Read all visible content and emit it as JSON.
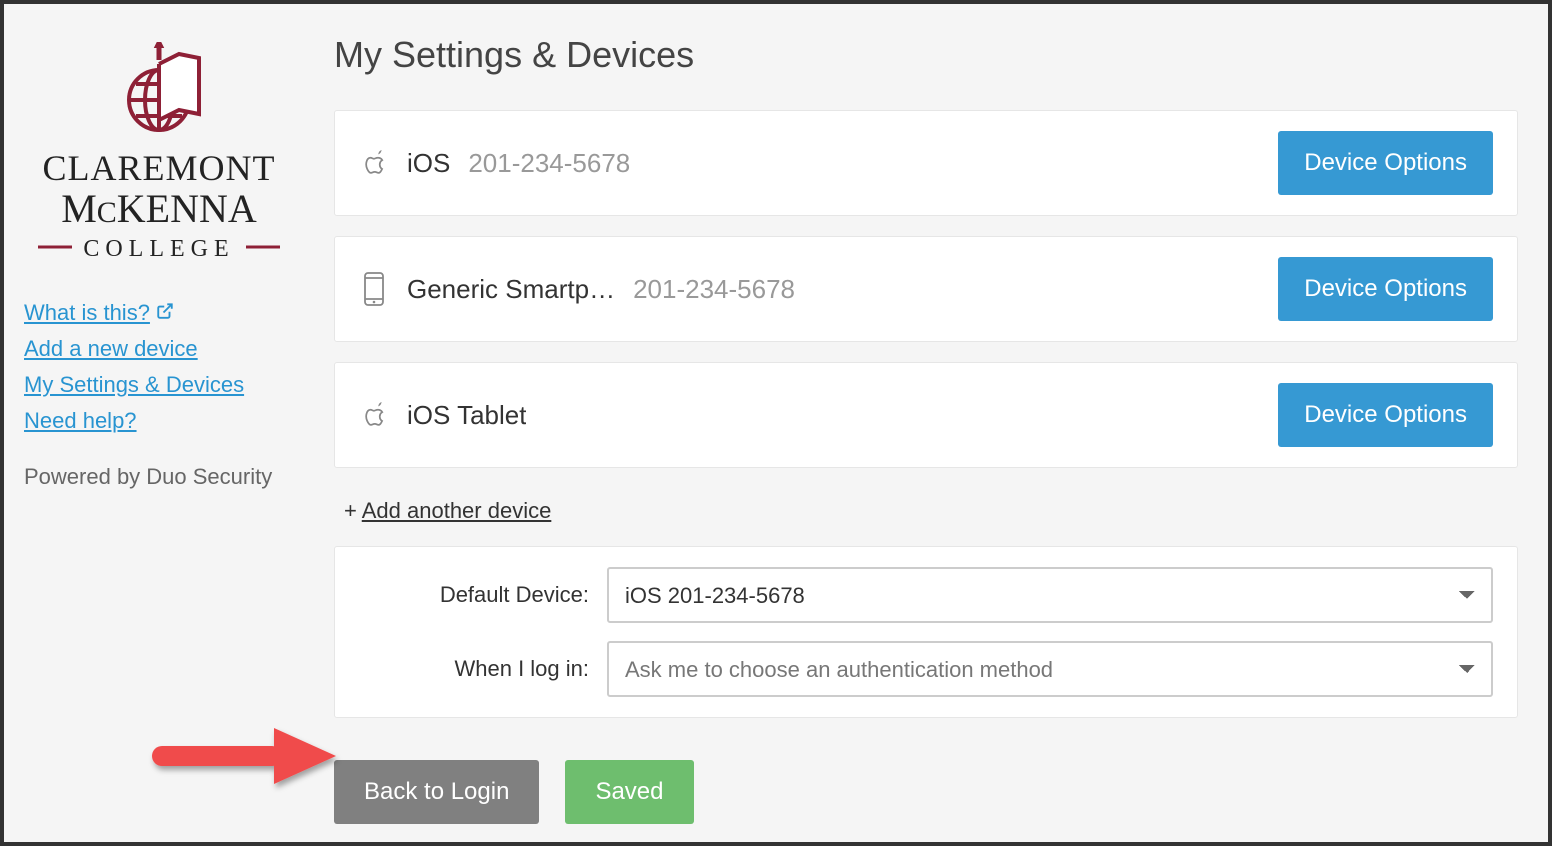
{
  "brand": {
    "line1": "CLAREMONT",
    "line2": "MCKENNA",
    "line3": "COLLEGE"
  },
  "sidebar": {
    "links": {
      "what": "What is this?",
      "add": "Add a new device",
      "settings": "My Settings & Devices",
      "help": "Need help?"
    },
    "powered": "Powered by Duo Security"
  },
  "page": {
    "title": "My Settings & Devices"
  },
  "devices": [
    {
      "name": "iOS",
      "phone": "201-234-5678",
      "btn": "Device Options",
      "icon": "apple"
    },
    {
      "name": "Generic Smartp…",
      "phone": "201-234-5678",
      "btn": "Device Options",
      "icon": "phone"
    },
    {
      "name": "iOS Tablet",
      "phone": "",
      "btn": "Device Options",
      "icon": "apple"
    }
  ],
  "addAnother": {
    "plus": "+ ",
    "label": "Add another device"
  },
  "settings": {
    "defaultLabel": "Default Device:",
    "defaultValue": "iOS 201-234-5678",
    "loginLabel": "When I log in:",
    "loginValue": "Ask me to choose an authentication method"
  },
  "actions": {
    "back": "Back to Login",
    "saved": "Saved"
  }
}
